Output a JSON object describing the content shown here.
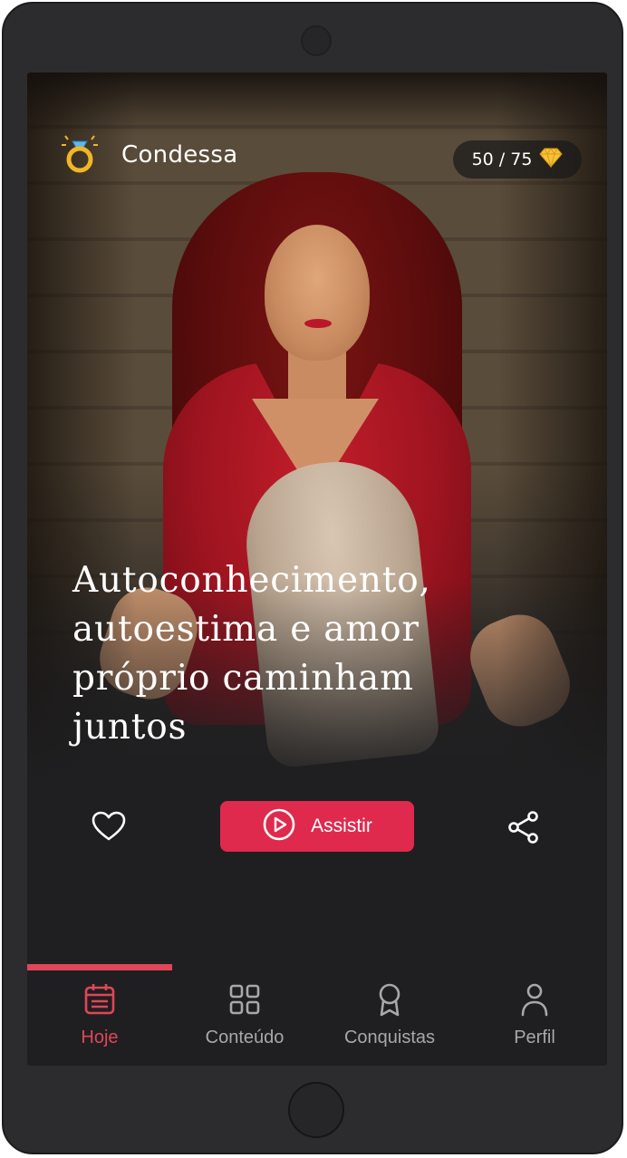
{
  "header": {
    "app_name": "Condessa",
    "score": "50 / 75",
    "logo_icon": "ring-icon",
    "score_icon": "diamond-icon"
  },
  "hero": {
    "headline": "Autoconhecimento, autoestima e amor próprio caminham juntos"
  },
  "actions": {
    "like_icon": "heart-icon",
    "play_label": "Assistir",
    "share_icon": "share-icon"
  },
  "nav": {
    "items": [
      {
        "label": "Hoje",
        "icon": "calendar-icon",
        "active": true
      },
      {
        "label": "Conteúdo",
        "icon": "grid-icon",
        "active": false
      },
      {
        "label": "Conquistas",
        "icon": "award-icon",
        "active": false
      },
      {
        "label": "Perfil",
        "icon": "user-icon",
        "active": false
      }
    ]
  },
  "colors": {
    "accent": "#df2a4d",
    "nav_active": "#e04658",
    "nav_inactive": "#a8a8a8",
    "background": "#1f1f21",
    "device": "#2c2c2e",
    "gold": "#f2b526"
  }
}
